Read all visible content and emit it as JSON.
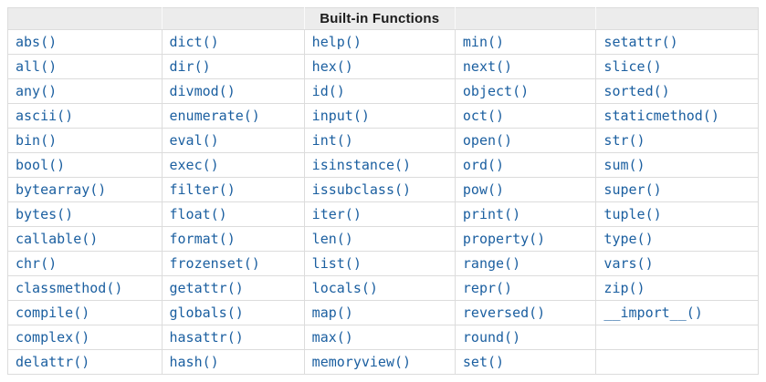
{
  "table": {
    "caption": "Built-in Functions",
    "columns": 5,
    "colors": {
      "link": "#1b5fa0",
      "border": "#dcdcdc",
      "header_background": "#ececec",
      "header_text": "#1b1b1b",
      "page_background": "#ffffff"
    },
    "rows": [
      [
        "abs()",
        "dict()",
        "help()",
        "min()",
        "setattr()"
      ],
      [
        "all()",
        "dir()",
        "hex()",
        "next()",
        "slice()"
      ],
      [
        "any()",
        "divmod()",
        "id()",
        "object()",
        "sorted()"
      ],
      [
        "ascii()",
        "enumerate()",
        "input()",
        "oct()",
        "staticmethod()"
      ],
      [
        "bin()",
        "eval()",
        "int()",
        "open()",
        "str()"
      ],
      [
        "bool()",
        "exec()",
        "isinstance()",
        "ord()",
        "sum()"
      ],
      [
        "bytearray()",
        "filter()",
        "issubclass()",
        "pow()",
        "super()"
      ],
      [
        "bytes()",
        "float()",
        "iter()",
        "print()",
        "tuple()"
      ],
      [
        "callable()",
        "format()",
        "len()",
        "property()",
        "type()"
      ],
      [
        "chr()",
        "frozenset()",
        "list()",
        "range()",
        "vars()"
      ],
      [
        "classmethod()",
        "getattr()",
        "locals()",
        "repr()",
        "zip()"
      ],
      [
        "compile()",
        "globals()",
        "map()",
        "reversed()",
        "__import__()"
      ],
      [
        "complex()",
        "hasattr()",
        "max()",
        "round()",
        ""
      ],
      [
        "delattr()",
        "hash()",
        "memoryview()",
        "set()",
        ""
      ]
    ]
  }
}
